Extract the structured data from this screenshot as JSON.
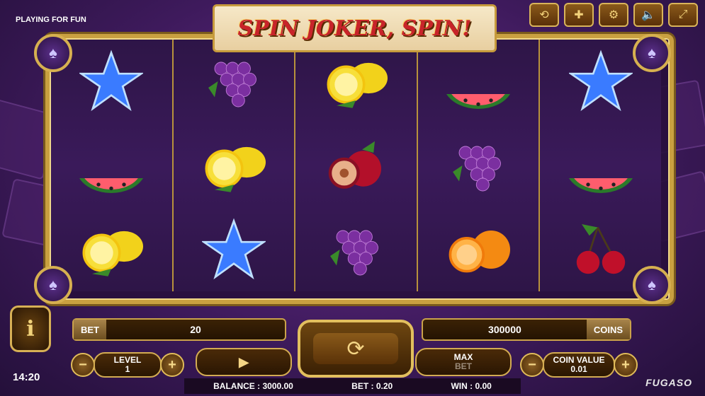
{
  "mode_label": "PLAYING FOR FUN",
  "clock": "14:20",
  "brand": "FUGASO",
  "logo_text": "SPIN JOKER, SPIN!",
  "top_controls": [
    "history-icon",
    "flag-uk-icon",
    "settings-icon",
    "sound-icon",
    "fullscreen-icon"
  ],
  "reels": [
    [
      "star",
      "watermelon",
      "lemon"
    ],
    [
      "grapes",
      "lemon",
      "star"
    ],
    [
      "lemon",
      "plum",
      "grapes"
    ],
    [
      "watermelon",
      "grapes",
      "orange"
    ],
    [
      "star",
      "watermelon",
      "cherry"
    ]
  ],
  "bet": {
    "label": "BET",
    "value": "20"
  },
  "coins": {
    "value": "300000",
    "label": "COINS"
  },
  "level": {
    "label": "LEVEL",
    "value": "1",
    "minus": "−",
    "plus": "+"
  },
  "coin_value": {
    "label": "COIN VALUE",
    "value": "0.01",
    "minus": "−",
    "plus": "+"
  },
  "max_bet": {
    "line1": "MAX",
    "line2": "BET"
  },
  "autoplay_icon": "play-icon",
  "info_label": "i",
  "status": {
    "balance": "BALANCE : 3000.00",
    "bet": "BET : 0.20",
    "win": "WIN : 0.00"
  }
}
